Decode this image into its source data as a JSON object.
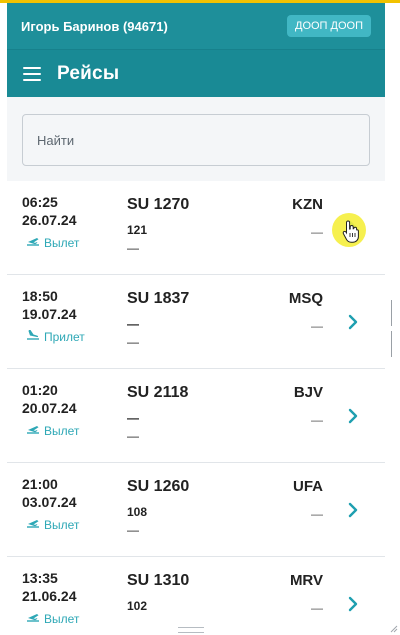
{
  "header": {
    "user": "Игорь Баринов (94671)",
    "badge": "ДООП ДООП",
    "title": "Рейсы"
  },
  "search": {
    "placeholder": "Найти",
    "value": ""
  },
  "colors": {
    "header": "#1e8f9a",
    "accent": "#2ea8b6",
    "badge": "#41b7c4",
    "highlight": "#f5ee3c"
  },
  "rows": [
    {
      "time": "06:25",
      "date": "26.07.24",
      "direction": "Вылет",
      "direction_icon": "departure-icon",
      "flight": "SU 1270",
      "sub": "121",
      "sub2": "—",
      "dest": "KZN",
      "dest_sub": "—"
    },
    {
      "time": "18:50",
      "date": "19.07.24",
      "direction": "Прилет",
      "direction_icon": "arrival-icon",
      "flight": "SU 1837",
      "sub": "—",
      "sub2": "—",
      "dest": "MSQ",
      "dest_sub": "—"
    },
    {
      "time": "01:20",
      "date": "20.07.24",
      "direction": "Вылет",
      "direction_icon": "departure-icon",
      "flight": "SU 2118",
      "sub": "—",
      "sub2": "—",
      "dest": "BJV",
      "dest_sub": "—"
    },
    {
      "time": "21:00",
      "date": "03.07.24",
      "direction": "Вылет",
      "direction_icon": "departure-icon",
      "flight": "SU 1260",
      "sub": "108",
      "sub2": "—",
      "dest": "UFA",
      "dest_sub": "—"
    },
    {
      "time": "13:35",
      "date": "21.06.24",
      "direction": "Вылет",
      "direction_icon": "departure-icon",
      "flight": "SU 1310",
      "sub": "102",
      "sub2": "—",
      "dest": "MRV",
      "dest_sub": "—"
    }
  ]
}
